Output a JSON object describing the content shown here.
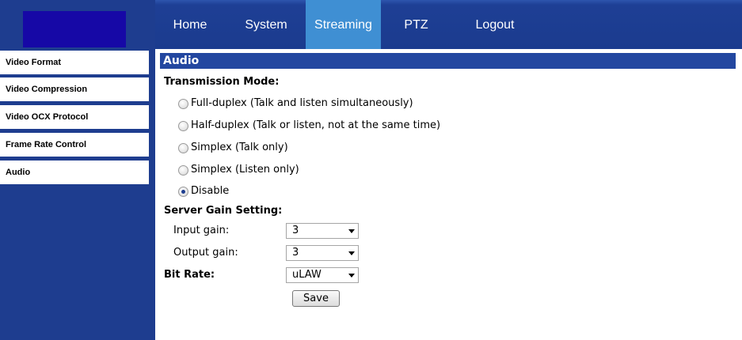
{
  "nav": {
    "items": [
      {
        "label": "Home"
      },
      {
        "label": "System"
      },
      {
        "label": "Streaming"
      },
      {
        "label": "PTZ"
      },
      {
        "label": "Logout"
      }
    ],
    "active": "Streaming"
  },
  "sidebar": {
    "items": [
      {
        "label": "Video Format"
      },
      {
        "label": "Video Compression"
      },
      {
        "label": "Video OCX Protocol"
      },
      {
        "label": "Frame Rate Control"
      },
      {
        "label": "Audio"
      }
    ]
  },
  "content": {
    "section_title": "Audio",
    "transmission_mode": {
      "heading": "Transmission Mode:",
      "options": [
        {
          "label": "Full-duplex (Talk and listen simultaneously)",
          "checked": false
        },
        {
          "label": "Half-duplex (Talk or listen, not at the same time)",
          "checked": false
        },
        {
          "label": "Simplex (Talk only)",
          "checked": false
        },
        {
          "label": "Simplex (Listen only)",
          "checked": false
        },
        {
          "label": "Disable",
          "checked": true
        }
      ]
    },
    "server_gain": {
      "heading": "Server Gain Setting:",
      "input_gain_label": "Input gain:",
      "input_gain_value": "3",
      "output_gain_label": "Output gain:",
      "output_gain_value": "3"
    },
    "bit_rate": {
      "label": "Bit Rate:",
      "value": "uLAW"
    },
    "save_label": "Save"
  },
  "colors": {
    "nav_bg": "#1b3b8e",
    "nav_active": "#3f8fd3",
    "sidebar_bg": "#1e3d8f",
    "logo_bg": "#1608a6",
    "section_header_bg": "#2347a0"
  }
}
